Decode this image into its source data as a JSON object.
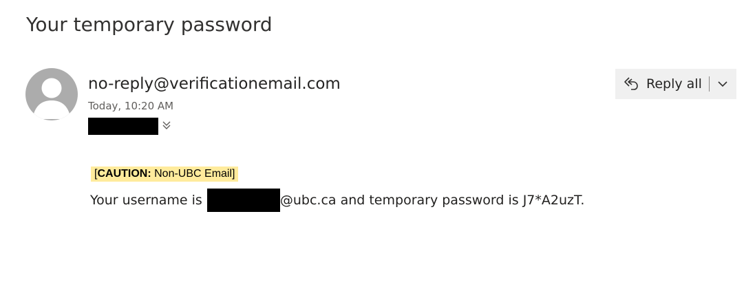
{
  "message": {
    "subject": "Your temporary password",
    "sender": "no-reply@verificationemail.com",
    "timestamp": "Today, 10:20 AM"
  },
  "actions": {
    "reply_all_label": "Reply all"
  },
  "banner": {
    "open_bracket": "[",
    "caution_bold": "CAUTION:",
    "caution_text": " Non-UBC Email",
    "close_bracket": "]"
  },
  "body": {
    "prefix": "Your username is ",
    "suffix": "@ubc.ca and temporary password is J7*A2uzT."
  },
  "icons": {
    "avatar": "person-placeholder-icon",
    "expand": "double-chevron-down-icon",
    "reply": "reply-all-icon",
    "menu": "chevron-down-icon"
  },
  "colors": {
    "caution_background": "#ffeb9c",
    "avatar_background": "#acacac",
    "button_background": "#f0f0f0",
    "redaction": "#000000"
  }
}
